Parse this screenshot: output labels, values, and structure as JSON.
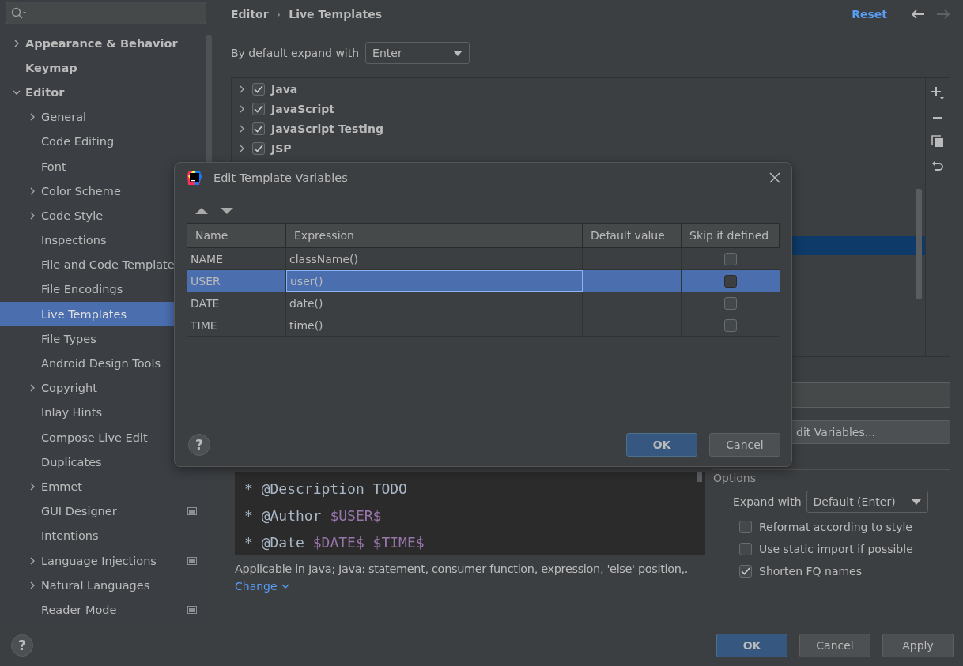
{
  "sidebar": {
    "items": [
      {
        "label": "Appearance & Behavior",
        "expanded": false,
        "selected": false
      },
      {
        "label": "Keymap",
        "selected": false
      },
      {
        "label": "Editor",
        "expanded": true,
        "selected": false,
        "children": [
          {
            "label": "General",
            "expanded": false,
            "selected": false
          },
          {
            "label": "Code Editing",
            "selected": false
          },
          {
            "label": "Font",
            "selected": false
          },
          {
            "label": "Color Scheme",
            "expanded": false,
            "selected": false
          },
          {
            "label": "Code Style",
            "expanded": false,
            "selected": false
          },
          {
            "label": "Inspections",
            "selected": false
          },
          {
            "label": "File and Code Template",
            "selected": false
          },
          {
            "label": "File Encodings",
            "selected": false
          },
          {
            "label": "Live Templates",
            "selected": true
          },
          {
            "label": "File Types",
            "selected": false
          },
          {
            "label": "Android Design Tools",
            "selected": false
          },
          {
            "label": "Copyright",
            "expanded": false,
            "selected": false
          },
          {
            "label": "Inlay Hints",
            "selected": false
          },
          {
            "label": "Compose Live Edit",
            "selected": false
          },
          {
            "label": "Duplicates",
            "selected": false
          },
          {
            "label": "Emmet",
            "expanded": false,
            "selected": false
          },
          {
            "label": "GUI Designer",
            "project_icon": true,
            "selected": false
          },
          {
            "label": "Intentions",
            "selected": false
          },
          {
            "label": "Language Injections",
            "expanded": false,
            "project_icon": true,
            "selected": false
          },
          {
            "label": "Natural Languages",
            "expanded": false,
            "selected": false
          },
          {
            "label": "Reader Mode",
            "project_icon": true,
            "selected": false
          }
        ]
      }
    ]
  },
  "help": "?",
  "header": {
    "breadcrumb": [
      "Editor",
      "Live Templates"
    ],
    "separator": "›",
    "reset": "Reset",
    "back_disabled": false,
    "forward_disabled": true
  },
  "expand_default": {
    "label": "By default expand with",
    "value": "Enter"
  },
  "template_groups": [
    {
      "label": "Java",
      "expanded": false,
      "checked": true
    },
    {
      "label": "JavaScript",
      "expanded": false,
      "checked": true
    },
    {
      "label": "JavaScript Testing",
      "expanded": false,
      "checked": true
    },
    {
      "label": "JSP",
      "expanded": false,
      "checked": true
    }
  ],
  "edit_variables_button": "dit Variables...",
  "editor_lines": [
    {
      "text": "* @Description TODO"
    },
    {
      "text": "* @Author ",
      "variable": "$USER$"
    },
    {
      "text": "* @Date ",
      "variable": "$DATE$ $TIME$"
    }
  ],
  "applicable": "Applicable in Java; Java: statement, consumer function, expression, 'else' position,.",
  "change_link": "Change",
  "options": {
    "title": "Options",
    "expand_with": {
      "label": "Expand with",
      "value": "Default (Enter)"
    },
    "checkboxes": [
      {
        "label": "Reformat according to style",
        "checked": false
      },
      {
        "label": "Use static import if possible",
        "checked": false
      },
      {
        "label": "Shorten FQ names",
        "checked": true
      }
    ]
  },
  "footer_buttons": [
    {
      "label": "OK",
      "kind": "primary"
    },
    {
      "label": "Cancel",
      "kind": "normal"
    },
    {
      "label": "Apply",
      "kind": "normal"
    }
  ],
  "dialog": {
    "title": "Edit Template Variables",
    "columns": [
      "Name",
      "Expression",
      "Default value",
      "Skip if defined"
    ],
    "rows": [
      {
        "name": "NAME",
        "expression": "className()",
        "skip_if_defined": false,
        "selected": false,
        "editing": false
      },
      {
        "name": "USER",
        "expression": "user()",
        "skip_if_defined": false,
        "selected": true,
        "editing": true
      },
      {
        "name": "DATE",
        "expression": "date()",
        "skip_if_defined": false,
        "selected": false,
        "editing": false
      },
      {
        "name": "TIME",
        "expression": "time()",
        "skip_if_defined": false,
        "selected": false,
        "editing": false
      }
    ],
    "help": "?",
    "buttons": [
      {
        "label": "OK",
        "kind": "primary"
      },
      {
        "label": "Cancel",
        "kind": "normal"
      }
    ]
  }
}
